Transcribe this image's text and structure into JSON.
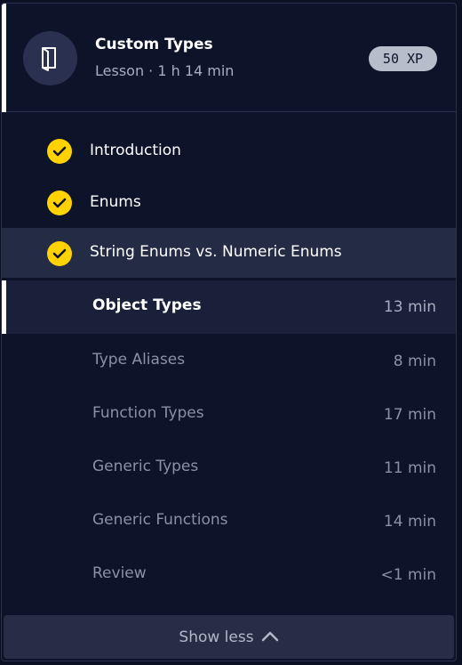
{
  "lesson": {
    "title": "Custom Types",
    "meta": "Lesson · 1 h 14 min",
    "xp": "50 XP",
    "icon": "book-icon"
  },
  "completed_sections": [
    {
      "label": "Introduction",
      "status": "completed"
    },
    {
      "label": "Enums",
      "status": "completed"
    },
    {
      "label": "String Enums vs. Numeric Enums",
      "status": "completed"
    }
  ],
  "subsections": [
    {
      "label": "Object Types",
      "duration": "13 min",
      "active": true
    },
    {
      "label": "Type Aliases",
      "duration": "8 min"
    },
    {
      "label": "Function Types",
      "duration": "17 min"
    },
    {
      "label": "Generic Types",
      "duration": "11 min"
    },
    {
      "label": "Generic Functions",
      "duration": "14 min"
    },
    {
      "label": "Review",
      "duration": "<1 min"
    }
  ],
  "footer": {
    "label": "Show less",
    "icon": "chevron-up-icon"
  },
  "colors": {
    "background": "#0d1329",
    "check": "#ffd200",
    "highlight_row": "#242b44",
    "active_row": "#1a2039",
    "xp_badge": "#b7bdca"
  }
}
